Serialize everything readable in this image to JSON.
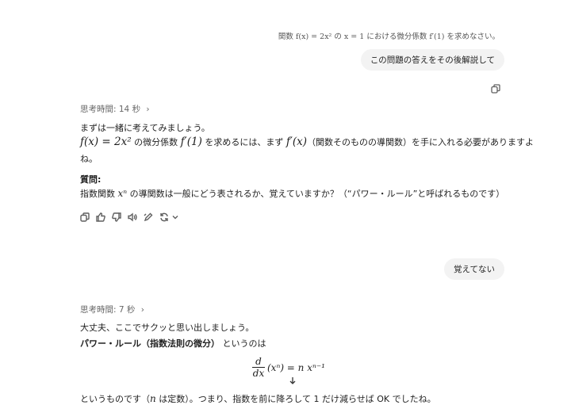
{
  "turn1": {
    "question_text": "関数 f(x) = 2x² の x = 1 における微分係数 f′(1) を求めなさい。",
    "user_message": "この問題の答えをその後解説して"
  },
  "response1": {
    "thinking_time": "思考時間: 14 秒",
    "intro": "まずは一緒に考えてみましょう。",
    "line2_part1": "f(x) = 2x²",
    "line2_part2": " の微分係数 ",
    "line2_part3": "f′(1)",
    "line2_part4": " を求めるには、まず ",
    "line2_part5": "f′(x)",
    "line2_part6": "（関数そのものの導関数）を手に入れる必要がありますよ",
    "line2_wrap": "ね。",
    "question_label": "質問:",
    "question_part1": "指数関数 ",
    "question_math": "xⁿ",
    "question_part2": " の導関数は一般にどう表されるか、覚えていますか？（“パワー・ルール”と呼ばれるものです）"
  },
  "turn2": {
    "user_message": "覚えてない"
  },
  "response2": {
    "thinking_time": "思考時間: 7 秒",
    "intro": "大丈夫、ここでサクッと思い出しましょう。",
    "rule_bold": "パワー・ルール（指数法則の微分）",
    "rule_rest": " というのは",
    "formula_num": "d",
    "formula_den": "dx",
    "formula_rhs": "(xⁿ) = n xⁿ⁻¹",
    "last_part1": "というものです（",
    "last_math": "n",
    "last_part2": " は定数）。つまり、指数を前に降ろして 1 だけ減らせば OK でしたね。"
  },
  "icons": [
    "copy-icon",
    "thumbs-up-icon",
    "thumbs-down-icon",
    "speaker-icon",
    "edit-icon",
    "regenerate-icon",
    "chevron-down-icon",
    "scroll-down-arrow-icon"
  ]
}
